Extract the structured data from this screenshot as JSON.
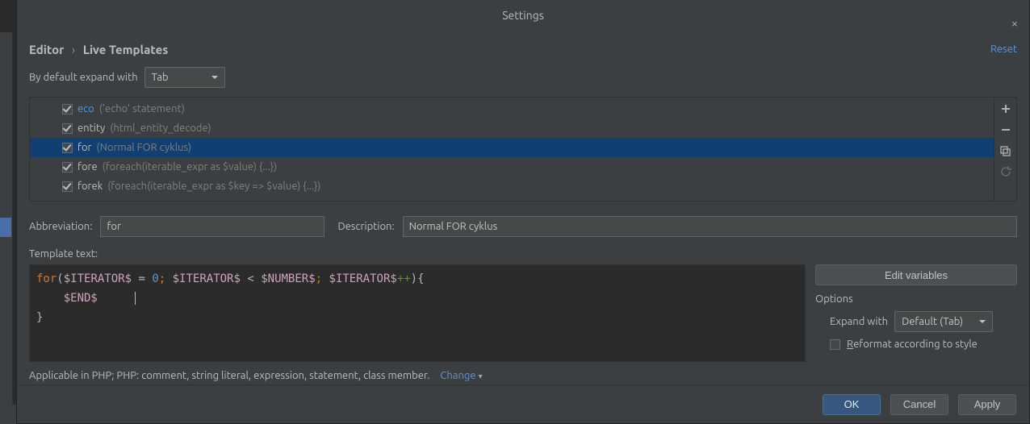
{
  "title": "Settings",
  "breadcrumb": {
    "a": "Editor",
    "b": "Live Templates"
  },
  "reset": "Reset",
  "expand_with_label": "By default expand with",
  "expand_with_value": "Tab",
  "templates": [
    {
      "name": "eco",
      "desc": "('echo' statement)",
      "checked": true,
      "link": true,
      "selected": false
    },
    {
      "name": "entity",
      "desc": "(html_entity_decode)",
      "checked": true,
      "link": false,
      "selected": false
    },
    {
      "name": "for",
      "desc": "(Normal FOR cyklus)",
      "checked": true,
      "link": false,
      "selected": true
    },
    {
      "name": "fore",
      "desc": "(foreach(iterable_expr as $value) {...})",
      "checked": true,
      "link": false,
      "selected": false
    },
    {
      "name": "forek",
      "desc": "(foreach(iterable_expr as $key => $value) {...})",
      "checked": true,
      "link": false,
      "selected": false
    }
  ],
  "abbr_label": "Abbreviation:",
  "abbr_value": "for",
  "desc_label": "Description:",
  "desc_value": "Normal FOR cyklus",
  "tmpl_label": "Template text:",
  "code": {
    "line1_kw": "for",
    "line1_open": "(",
    "line1_v1": "$ITERATOR$",
    "line1_eq": " = ",
    "line1_zero": "0",
    "line1_semi1": "; ",
    "line1_v2": "$ITERATOR$",
    "line1_lt": " < ",
    "line1_v3": "$NUMBER$",
    "line1_semi2": "; ",
    "line1_v4": "$ITERATOR$",
    "line1_inc": "++",
    "line1_close": "){",
    "line2_indent": "    ",
    "line2_end": "$END$",
    "line3": "}"
  },
  "edit_vars": "Edit variables",
  "options_title": "Options",
  "opt_expand_label": "Expand with",
  "opt_expand_value": "Default (Tab)",
  "opt_reformat": "Reformat according to style",
  "opt_reformat_u": "R",
  "opt_reformat_rest": "eformat according to style",
  "applicable": "Applicable in PHP; PHP: comment, string literal, expression, statement, class member.",
  "change": "Change",
  "buttons": {
    "ok": "OK",
    "cancel": "Cancel",
    "apply": "Apply"
  }
}
